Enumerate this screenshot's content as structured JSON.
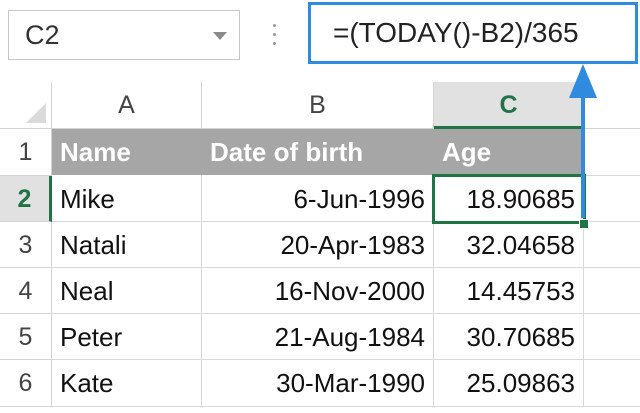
{
  "name_box": {
    "value": "C2"
  },
  "formula_bar": {
    "formula": "=(TODAY()-B2)/365"
  },
  "columns": [
    "A",
    "B",
    "C"
  ],
  "active_column": "C",
  "rows": [
    "1",
    "2",
    "3",
    "4",
    "5",
    "6"
  ],
  "active_row": "2",
  "header_row": {
    "name": "Name",
    "dob": "Date of birth",
    "age": "Age"
  },
  "records": [
    {
      "name": "Mike",
      "dob": "6-Jun-1996",
      "age": "18.90685"
    },
    {
      "name": "Natali",
      "dob": "20-Apr-1983",
      "age": "32.04658"
    },
    {
      "name": "Neal",
      "dob": "16-Nov-2000",
      "age": "14.45753"
    },
    {
      "name": "Peter",
      "dob": "21-Aug-1984",
      "age": "30.70685"
    },
    {
      "name": "Kate",
      "dob": "30-Mar-1990",
      "age": "25.09863"
    }
  ],
  "colors": {
    "selection": "#217346",
    "header_fill": "#a6a6a6",
    "annotation": "#2e8bde"
  }
}
